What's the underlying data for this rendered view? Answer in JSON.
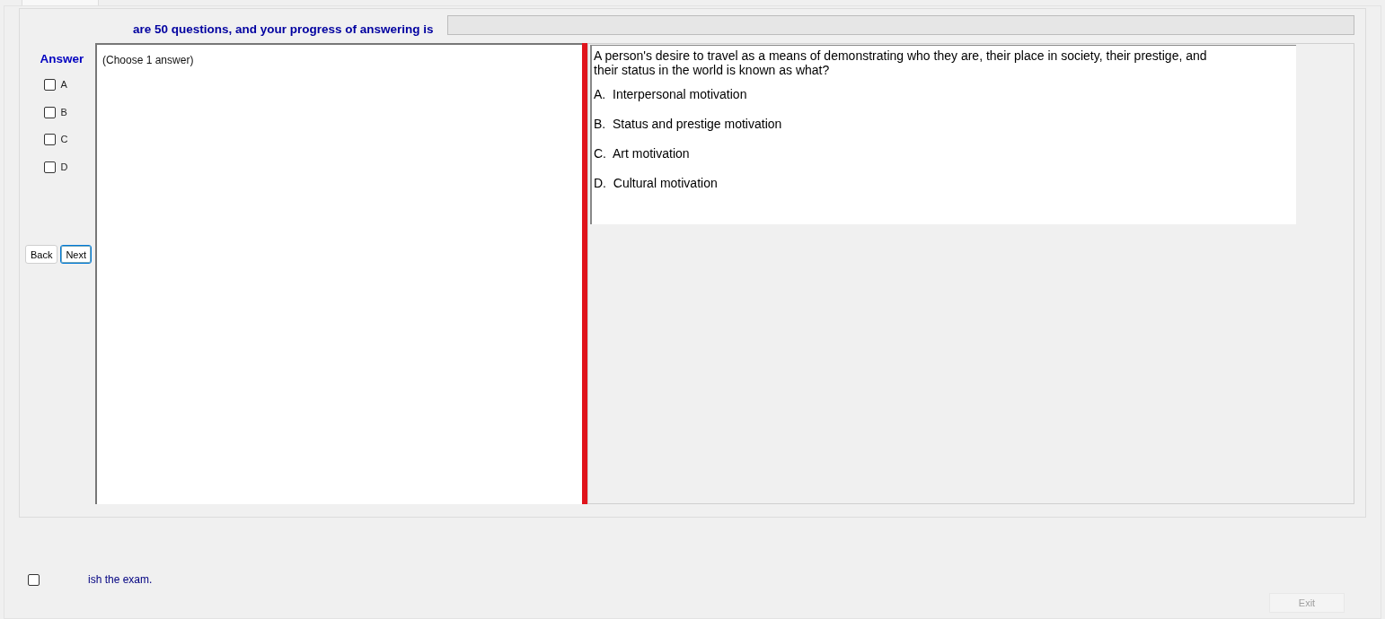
{
  "header": {
    "text": "are 50 questions, and your progress of answering is",
    "progress": {
      "level": 0
    }
  },
  "answer_panel": {
    "title": "Answer",
    "options": [
      {
        "label": "A",
        "checked": false
      },
      {
        "label": "B",
        "checked": false
      },
      {
        "label": "C",
        "checked": false
      },
      {
        "label": "D",
        "checked": false
      }
    ],
    "buttons": [
      {
        "label": "Back",
        "kind": "plain"
      },
      {
        "label": "Next",
        "kind": "focused"
      }
    ]
  },
  "answer_box": {
    "hint": "(Choose 1 answer)"
  },
  "question": {
    "text": "A person's desire to travel as a means of demonstrating who they are, their place in society, their prestige, and their status in the world is known as what?",
    "choices": [
      "A.  Interpersonal motivation",
      "B.  Status and prestige motivation",
      "C.  Art motivation",
      "D.  Cultural motivation"
    ]
  },
  "finish": {
    "label": "ish the exam.",
    "checked": false
  },
  "exit_button": {
    "label": "Exit",
    "disabled": true
  }
}
